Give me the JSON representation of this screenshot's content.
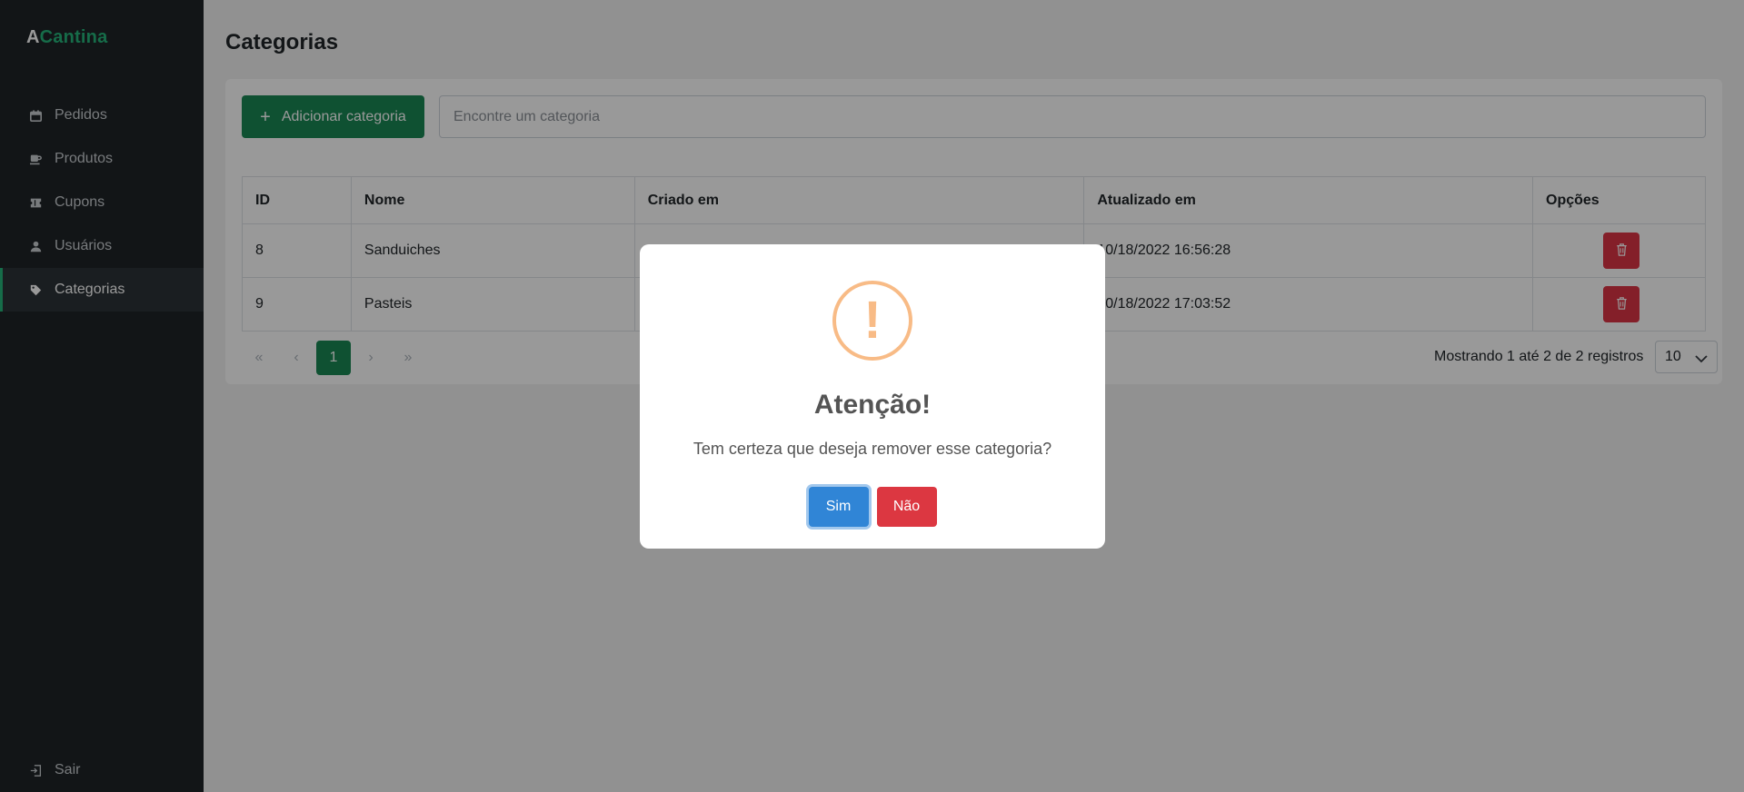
{
  "brand": {
    "first": "A",
    "rest": "Cantina",
    "accent": "#25b57a"
  },
  "sidebar": {
    "items": [
      {
        "label": "Pedidos",
        "icon": "calendar-icon"
      },
      {
        "label": "Produtos",
        "icon": "coffee-icon"
      },
      {
        "label": "Cupons",
        "icon": "ticket-icon"
      },
      {
        "label": "Usuários",
        "icon": "user-icon"
      },
      {
        "label": "Categorias",
        "icon": "tag-icon",
        "active": true
      }
    ],
    "logout": {
      "label": "Sair",
      "icon": "logout-icon"
    }
  },
  "page": {
    "title": "Categorias"
  },
  "toolbar": {
    "add_label": "Adicionar categoria",
    "search_placeholder": "Encontre um categoria"
  },
  "table": {
    "headers": [
      "ID",
      "Nome",
      "Criado em",
      "Atualizado em",
      "Opções"
    ],
    "rows": [
      {
        "id": "8",
        "nome": "Sanduiches",
        "criado": "",
        "atualizado": "10/18/2022 16:56:28"
      },
      {
        "id": "9",
        "nome": "Pasteis",
        "criado": "",
        "atualizado": "10/18/2022 17:03:52"
      }
    ]
  },
  "pagination": {
    "first": "«",
    "prev": "‹",
    "current": "1",
    "next": "›",
    "last": "»",
    "showing": "Mostrando 1 até 2 de 2 registros",
    "per_page": "10"
  },
  "modal": {
    "icon": "warning-icon",
    "icon_mark": "!",
    "title": "Atenção!",
    "text": "Tem certeza que deseja remover esse categoria?",
    "confirm_label": "Sim",
    "cancel_label": "Não"
  },
  "colors": {
    "primary_green": "#198754",
    "danger": "#dc3545",
    "confirm_blue": "#3085d6",
    "warning": "#f8bb86",
    "sidebar_bg": "#1e2327"
  }
}
